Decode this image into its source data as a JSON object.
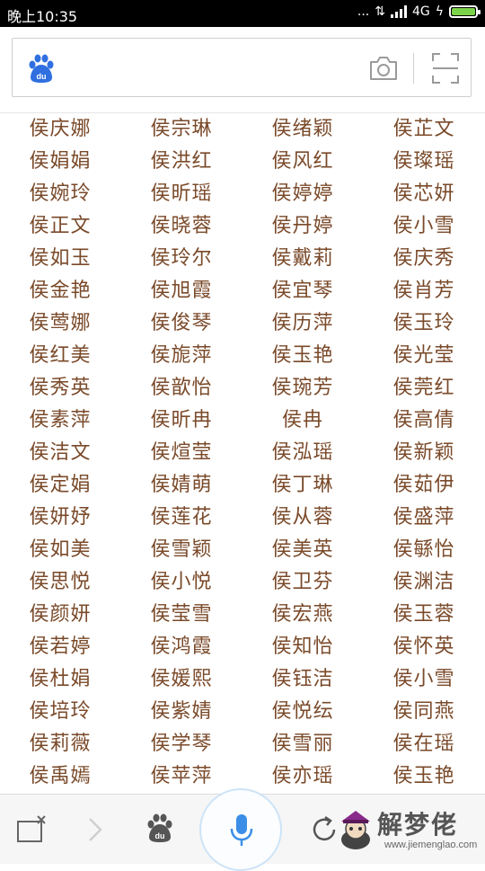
{
  "status_bar": {
    "time": "晚上10:35",
    "dots": "...",
    "network": "4G"
  },
  "search": {
    "logo_icon": "baidu-paw-icon",
    "camera_icon": "camera-icon",
    "scan_icon": "scan-icon"
  },
  "names": [
    [
      "侯庆娜",
      "侯宗琳",
      "侯绪颖",
      "侯芷文"
    ],
    [
      "侯娟娟",
      "侯洪红",
      "侯风红",
      "侯璨瑶"
    ],
    [
      "侯婉玲",
      "侯昕瑶",
      "侯婷婷",
      "侯芯妍"
    ],
    [
      "侯正文",
      "侯晓蓉",
      "侯丹婷",
      "侯小雪"
    ],
    [
      "侯如玉",
      "侯玲尔",
      "侯戴莉",
      "侯庆秀"
    ],
    [
      "侯金艳",
      "侯旭霞",
      "侯宜琴",
      "侯肖芳"
    ],
    [
      "侯莺娜",
      "侯俊琴",
      "侯历萍",
      "侯玉玲"
    ],
    [
      "侯红美",
      "侯旎萍",
      "侯玉艳",
      "侯光莹"
    ],
    [
      "侯秀英",
      "侯歆怡",
      "侯琬芳",
      "侯莞红"
    ],
    [
      "侯素萍",
      "侯昕冉",
      "侯冉",
      "侯高倩"
    ],
    [
      "侯洁文",
      "侯煊莹",
      "侯泓瑶",
      "侯新颖"
    ],
    [
      "侯定娟",
      "侯婧萌",
      "侯丁琳",
      "侯茹伊"
    ],
    [
      "侯妍妤",
      "侯莲花",
      "侯从蓉",
      "侯盛萍"
    ],
    [
      "侯如美",
      "侯雪颖",
      "侯美英",
      "侯緐怡"
    ],
    [
      "侯思悦",
      "侯小悦",
      "侯卫芬",
      "侯渊洁"
    ],
    [
      "侯颜妍",
      "侯莹雪",
      "侯宏燕",
      "侯玉蓉"
    ],
    [
      "侯若婷",
      "侯鸿霞",
      "侯知怡",
      "侯怀英"
    ],
    [
      "侯杜娟",
      "侯媛熙",
      "侯钰洁",
      "侯小雪"
    ],
    [
      "侯培玲",
      "侯紫婧",
      "侯悦纭",
      "侯同燕"
    ],
    [
      "侯莉薇",
      "侯学琴",
      "侯雪丽",
      "侯在瑶"
    ],
    [
      "侯禹嫣",
      "侯苹萍",
      "侯亦瑶",
      "侯玉艳"
    ]
  ],
  "toolbar": {
    "close_icon": "close-window-icon",
    "forward_icon": "chevron-right-icon",
    "paw_icon": "baidu-paw-icon",
    "mic_icon": "microphone-icon",
    "refresh_icon": "refresh-icon"
  },
  "watermark": {
    "title": "解梦佬",
    "url": "www.jiemenglao.com"
  },
  "colors": {
    "name_text": "#7a4a2a",
    "baidu_blue": "#2f6fe0",
    "mic_blue": "#3b8ee8",
    "battery_green": "#7bd34a"
  }
}
